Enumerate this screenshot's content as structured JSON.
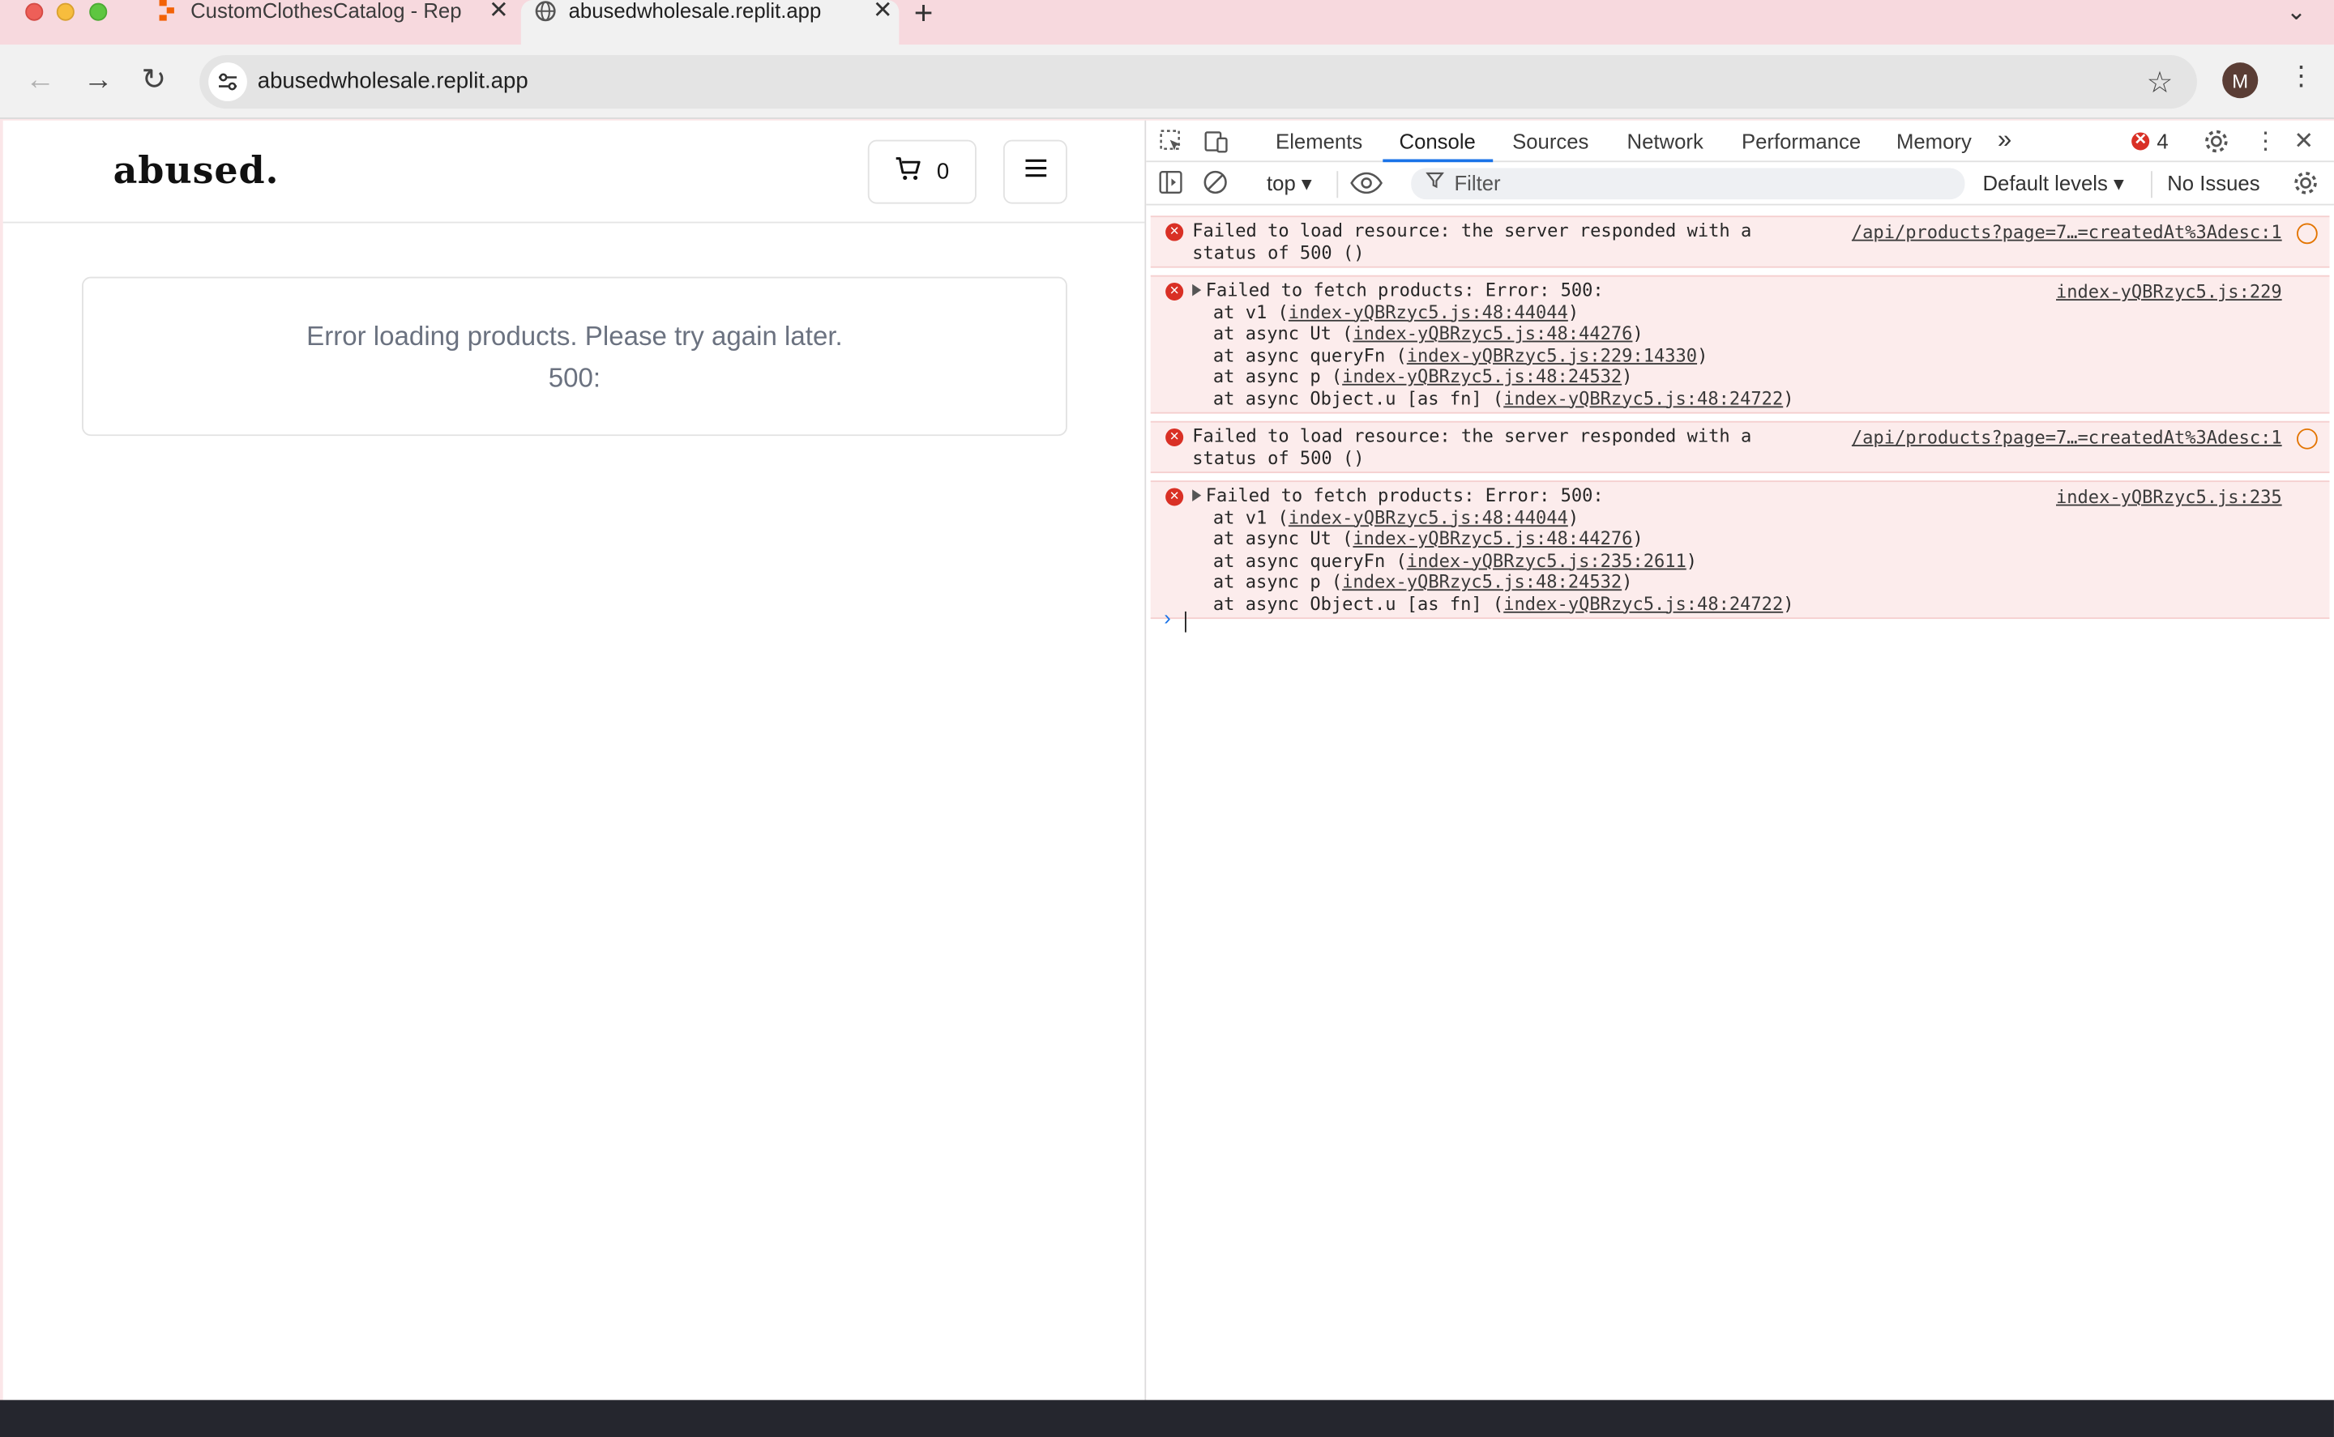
{
  "browser": {
    "tabs": [
      {
        "title": "CustomClothesCatalog - Rep",
        "active": false
      },
      {
        "title": "abusedwholesale.replit.app",
        "active": true
      }
    ],
    "new_tab": "+",
    "url": "abusedwholesale.replit.app",
    "profile_initial": "M"
  },
  "site": {
    "logo": "abused.",
    "cart_count": "0",
    "error_message": "Error loading products. Please try again later.",
    "error_code": "500:"
  },
  "devtools": {
    "tabs": [
      "Elements",
      "Console",
      "Sources",
      "Network",
      "Performance",
      "Memory"
    ],
    "more": "»",
    "error_count": "4",
    "context": "top",
    "filter_placeholder": "Filter",
    "levels": "Default levels",
    "issues": "No Issues",
    "messages": [
      {
        "type": "resource",
        "lines": [
          "Failed to load resource: the server responded with a",
          "status of 500 ()"
        ],
        "source": "/api/products?page=7…=createdAt%3Adesc:1"
      },
      {
        "type": "stack",
        "head": "Failed to fetch products: Error: 500:",
        "source": "index-yQBRzyc5.js:229",
        "frames": [
          {
            "pre": "at v1 (",
            "link": "index-yQBRzyc5.js:48:44044",
            "post": ")"
          },
          {
            "pre": "at async Ut (",
            "link": "index-yQBRzyc5.js:48:44276",
            "post": ")"
          },
          {
            "pre": "at async queryFn (",
            "link": "index-yQBRzyc5.js:229:14330",
            "post": ")"
          },
          {
            "pre": "at async p (",
            "link": "index-yQBRzyc5.js:48:24532",
            "post": ")"
          },
          {
            "pre": "at async Object.u [as fn] (",
            "link": "index-yQBRzyc5.js:48:24722",
            "post": ")"
          }
        ]
      },
      {
        "type": "resource",
        "lines": [
          "Failed to load resource: the server responded with a",
          "status of 500 ()"
        ],
        "source": "/api/products?page=7…=createdAt%3Adesc:1"
      },
      {
        "type": "stack",
        "head": "Failed to fetch products: Error: 500:",
        "source": "index-yQBRzyc5.js:235",
        "frames": [
          {
            "pre": "at v1 (",
            "link": "index-yQBRzyc5.js:48:44044",
            "post": ")"
          },
          {
            "pre": "at async Ut (",
            "link": "index-yQBRzyc5.js:48:44276",
            "post": ")"
          },
          {
            "pre": "at async queryFn (",
            "link": "index-yQBRzyc5.js:235:2611",
            "post": ")"
          },
          {
            "pre": "at async p (",
            "link": "index-yQBRzyc5.js:48:24532",
            "post": ")"
          },
          {
            "pre": "at async Object.u [as fn] (",
            "link": "index-yQBRzyc5.js:48:24722",
            "post": ")"
          }
        ]
      }
    ]
  },
  "colors": {
    "tabstrip": "#f7d9de",
    "error_red": "#d93025",
    "active_tab_underline": "#1a73e8",
    "error_row_bg": "#fcecec"
  }
}
